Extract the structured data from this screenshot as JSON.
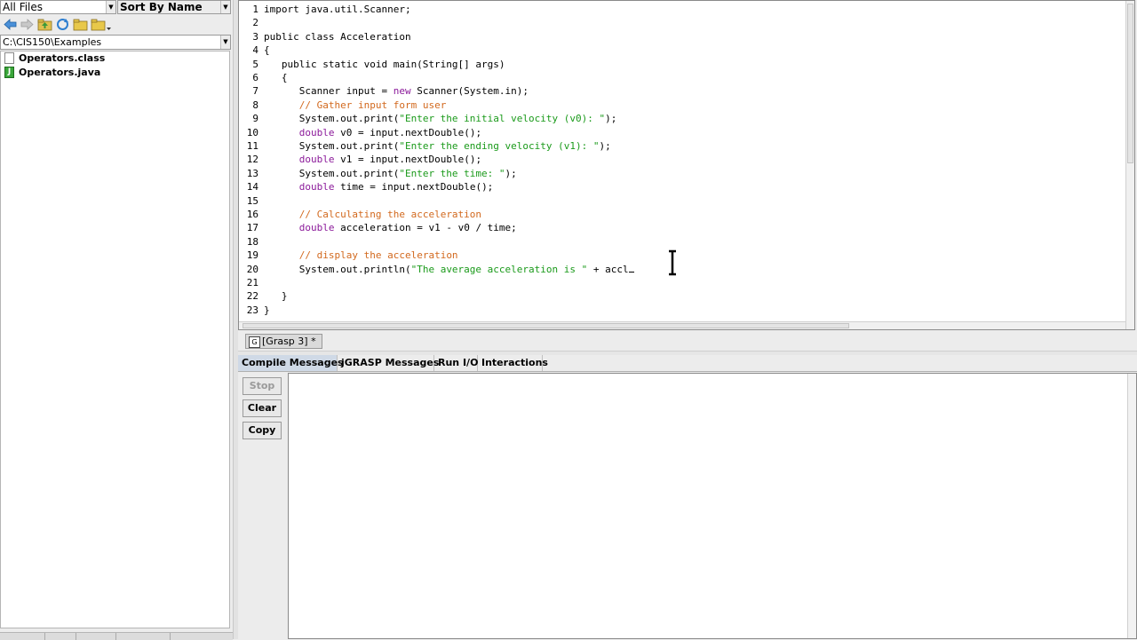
{
  "browse": {
    "filter": "All Files",
    "sort": "Sort By Name",
    "path": "C:\\CIS150\\Examples",
    "files": [
      {
        "name": "Operators.class",
        "type": "class"
      },
      {
        "name": "Operators.java",
        "type": "java"
      }
    ]
  },
  "editor": {
    "line_numbers": [
      "1",
      "2",
      "3",
      "4",
      "5",
      "6",
      "7",
      "8",
      "9",
      "10",
      "11",
      "12",
      "13",
      "14",
      "15",
      "16",
      "17",
      "18",
      "19",
      "20",
      "21",
      "22",
      "23"
    ],
    "lines": [
      [
        {
          "t": "import java.util.Scanner;"
        }
      ],
      [],
      [
        {
          "t": "public class Acceleration"
        }
      ],
      [
        {
          "t": "{"
        }
      ],
      [
        {
          "t": "   public static void main(String[] args)"
        }
      ],
      [
        {
          "t": "   {"
        }
      ],
      [
        {
          "t": "      Scanner input = "
        },
        {
          "t": "new",
          "c": "kw"
        },
        {
          "t": " Scanner(System.in);"
        }
      ],
      [
        {
          "t": "      "
        },
        {
          "t": "// Gather input form user",
          "c": "cmt"
        }
      ],
      [
        {
          "t": "      System.out.print("
        },
        {
          "t": "\"Enter the initial velocity (v0): \"",
          "c": "str"
        },
        {
          "t": ");"
        }
      ],
      [
        {
          "t": "      "
        },
        {
          "t": "double",
          "c": "kw"
        },
        {
          "t": " v0 = input.nextDouble();"
        }
      ],
      [
        {
          "t": "      System.out.print("
        },
        {
          "t": "\"Enter the ending velocity (v1): \"",
          "c": "str"
        },
        {
          "t": ");"
        }
      ],
      [
        {
          "t": "      "
        },
        {
          "t": "double",
          "c": "kw"
        },
        {
          "t": " v1 = input.nextDouble();"
        }
      ],
      [
        {
          "t": "      System.out.print("
        },
        {
          "t": "\"Enter the time: \"",
          "c": "str"
        },
        {
          "t": ");"
        }
      ],
      [
        {
          "t": "      "
        },
        {
          "t": "double",
          "c": "kw"
        },
        {
          "t": " time = input.nextDouble();"
        }
      ],
      [],
      [
        {
          "t": "      "
        },
        {
          "t": "// Calculating the acceleration",
          "c": "cmt"
        }
      ],
      [
        {
          "t": "      "
        },
        {
          "t": "double",
          "c": "kw"
        },
        {
          "t": " acceleration = v1 - v0 / time;"
        }
      ],
      [],
      [
        {
          "t": "      "
        },
        {
          "t": "// display the acceleration",
          "c": "cmt"
        }
      ],
      [
        {
          "t": "      System.out.println("
        },
        {
          "t": "\"The average acceleration is \"",
          "c": "str"
        },
        {
          "t": " + accl"
        },
        {
          "t": "",
          "c": "caret"
        }
      ],
      [],
      [
        {
          "t": "   }"
        }
      ],
      [
        {
          "t": "}"
        }
      ]
    ]
  },
  "window_tab": {
    "label": "[Grasp 3] *"
  },
  "messages": {
    "tabs": [
      "Compile Messages",
      "jGRASP Messages",
      "Run I/O",
      "Interactions"
    ],
    "active_tab": "Compile Messages",
    "buttons": {
      "stop": "Stop",
      "clear": "Clear",
      "copy": "Copy"
    }
  },
  "colors": {
    "keyword": "#8b1a9a",
    "string": "#1a9a1a",
    "comment": "#d2691e",
    "active_tab": "#cfd9e6"
  }
}
